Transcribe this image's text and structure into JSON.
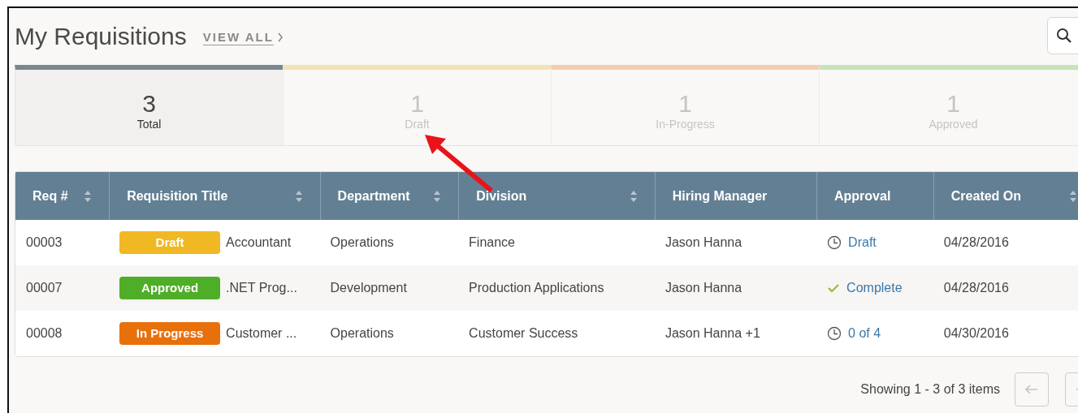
{
  "header": {
    "title": "My Requisitions",
    "view_all": "VIEW ALL"
  },
  "stats": [
    {
      "count": "3",
      "label": "Total",
      "selected": true,
      "color": "#7a8791"
    },
    {
      "count": "1",
      "label": "Draft",
      "selected": false,
      "color": "#f3e2b3"
    },
    {
      "count": "1",
      "label": "In-Progress",
      "selected": false,
      "color": "#f3cdae"
    },
    {
      "count": "1",
      "label": "Approved",
      "selected": false,
      "color": "#c8e3b9"
    }
  ],
  "table": {
    "columns": [
      {
        "label": "Req #",
        "sortable": true
      },
      {
        "label": "Requisition Title",
        "sortable": true
      },
      {
        "label": "Department",
        "sortable": true
      },
      {
        "label": "Division",
        "sortable": true
      },
      {
        "label": "Hiring Manager",
        "sortable": false
      },
      {
        "label": "Approval",
        "sortable": false
      },
      {
        "label": "Created On",
        "sortable": true
      }
    ],
    "rows": [
      {
        "req": "00003",
        "status": "Draft",
        "color": "#f0b823",
        "title": "Accountant",
        "department": "Operations",
        "division": "Finance",
        "manager": "Jason Hanna",
        "approval": {
          "kind": "pending",
          "text": "Draft"
        },
        "created": "04/28/2016"
      },
      {
        "req": "00007",
        "status": "Approved",
        "color": "#4fae27",
        "title": ".NET Prog...",
        "department": "Development",
        "division": "Production Applications",
        "manager": "Jason Hanna",
        "approval": {
          "kind": "complete",
          "text": "Complete"
        },
        "created": "04/28/2016"
      },
      {
        "req": "00008",
        "status": "In Progress",
        "color": "#e8700a",
        "title": "Customer ...",
        "department": "Operations",
        "division": "Customer Success",
        "manager": "Jason Hanna +1",
        "approval": {
          "kind": "pending",
          "text": "0 of 4"
        },
        "created": "04/30/2016"
      }
    ]
  },
  "pagination": {
    "summary": "Showing 1 - 3 of 3 items"
  }
}
